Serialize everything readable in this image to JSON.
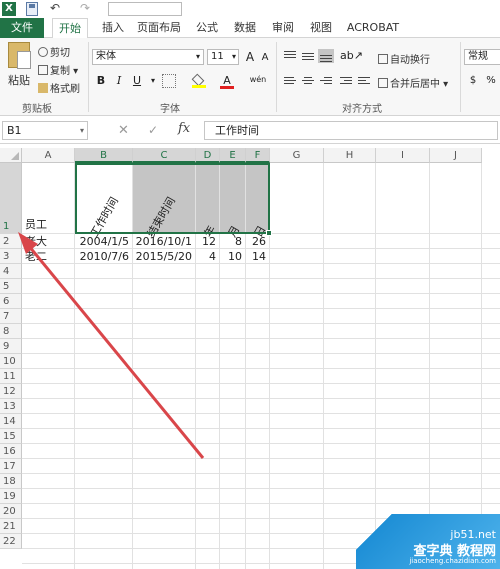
{
  "app": {
    "logo": "X"
  },
  "tabs": [
    "文件",
    "开始",
    "插入",
    "页面布局",
    "公式",
    "数据",
    "审阅",
    "视图",
    "ACROBAT"
  ],
  "clipboard": {
    "paste": "粘贴",
    "cut": "剪切",
    "copy": "复制",
    "format_painter": "格式刷",
    "group": "剪贴板"
  },
  "font": {
    "name": "宋体",
    "size": "11",
    "bold": "B",
    "italic": "I",
    "underline": "U",
    "grow": "A",
    "shrink": "A",
    "font_color": "A",
    "phonetic": "wén",
    "group": "字体"
  },
  "alignment": {
    "wrap": "自动换行",
    "merge": "合并后居中",
    "group": "对齐方式"
  },
  "number": {
    "format": "常规"
  },
  "formula_bar": {
    "name_box": "B1",
    "cancel": "✕",
    "enter": "✓",
    "fx": "fx",
    "content": "工作时间"
  },
  "columns": [
    "A",
    "B",
    "C",
    "D",
    "E",
    "F",
    "G",
    "H",
    "I",
    "J"
  ],
  "rows": [
    "1",
    "2",
    "3",
    "4",
    "5",
    "6",
    "7",
    "8",
    "9",
    "10",
    "11",
    "12",
    "13",
    "14",
    "15",
    "16",
    "17",
    "18",
    "19",
    "20",
    "21",
    "22"
  ],
  "sheet": {
    "header": {
      "a": "员工",
      "b": "工作时间",
      "c": "结束时间",
      "d": "年",
      "e": "月",
      "f": "日"
    },
    "rows": [
      {
        "a": "老大",
        "b": "2004/1/5",
        "c": "2016/10/1",
        "d": "12",
        "e": "8",
        "f": "26"
      },
      {
        "a": "老二",
        "b": "2010/7/6",
        "c": "2015/5/20",
        "d": "4",
        "e": "10",
        "f": "14"
      }
    ]
  },
  "watermark": {
    "line1": "jb51.net",
    "line2": "查字典 教程网",
    "line3": "jiaocheng.chazidian.com"
  },
  "colors": {
    "accent": "#217346",
    "arrow": "#d9464a"
  }
}
